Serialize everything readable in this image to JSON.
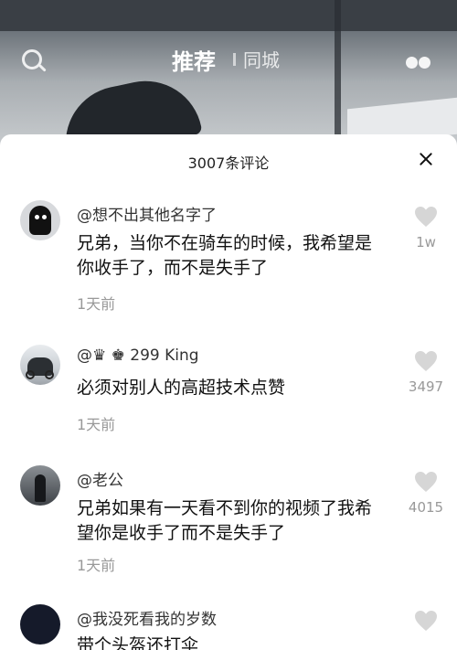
{
  "top_nav": {
    "tab_recommended": "推荐",
    "tab_local": "同城"
  },
  "comments_panel": {
    "title": "3007条评论",
    "comments": [
      {
        "username": "@想不出其他名字了",
        "text": "兄弟，当你不在骑车的时候，我希望是你收手了，而不是失手了",
        "time": "1天前",
        "likes": "1w"
      },
      {
        "username": "@♛ ♚ 299 King",
        "text": "必须对别人的高超技术点赞",
        "time": "1天前",
        "likes": "3497"
      },
      {
        "username": "@老公",
        "text": "兄弟如果有一天看不到你的视频了我希望你是收手了而不是失手了",
        "time": "1天前",
        "likes": "4015"
      },
      {
        "username": "@我没死看我的岁数",
        "text": "带个头盔还打伞",
        "time": "",
        "likes": ""
      }
    ]
  },
  "colors": {
    "sheet_background": "#ffffff",
    "heart_gray": "#d6d6d6",
    "secondary_text": "#999999"
  },
  "icons": [
    "search-icon",
    "more-dots-icon",
    "close-icon",
    "heart-icon"
  ]
}
